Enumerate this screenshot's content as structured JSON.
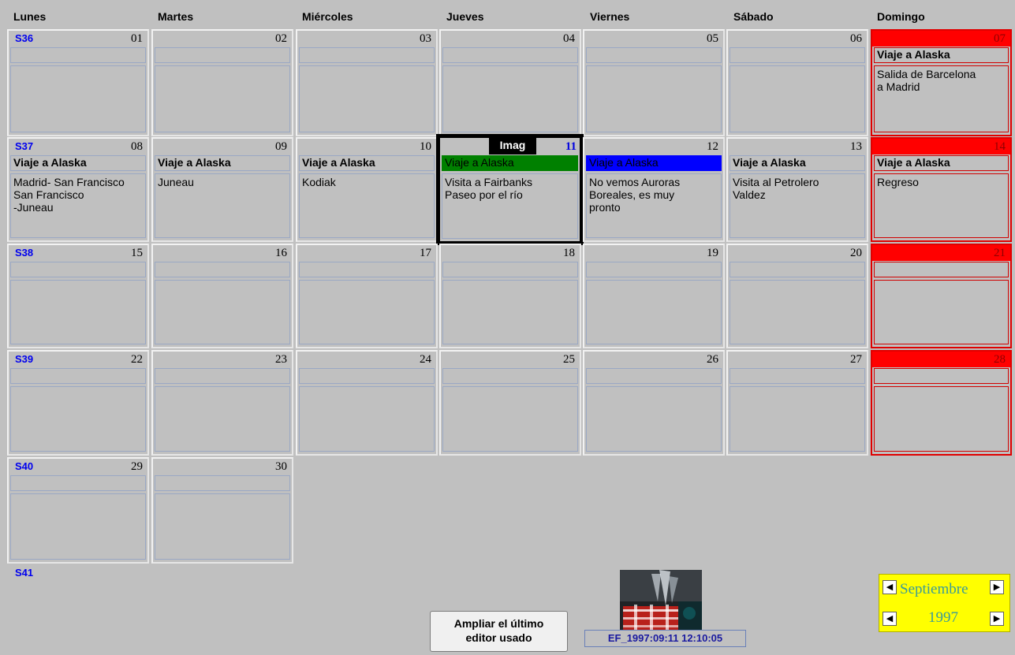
{
  "days": [
    "Lunes",
    "Martes",
    "Miércoles",
    "Jueves",
    "Viernes",
    "Sábado",
    "Domingo"
  ],
  "weeks": [
    "S36",
    "S37",
    "S38",
    "S39",
    "S40",
    "S41"
  ],
  "dates": {
    "r0": [
      "01",
      "02",
      "03",
      "04",
      "05",
      "06",
      "07"
    ],
    "r1": [
      "08",
      "09",
      "10",
      "11",
      "12",
      "13",
      "14"
    ],
    "r2": [
      "15",
      "16",
      "17",
      "18",
      "19",
      "20",
      "21"
    ],
    "r3": [
      "22",
      "23",
      "24",
      "25",
      "26",
      "27",
      "28"
    ],
    "r4": [
      "29",
      "30"
    ]
  },
  "events": {
    "d07": {
      "title": "Viaje a Alaska",
      "notes": "Salida de Barcelona\na Madrid"
    },
    "d08": {
      "title": "Viaje a Alaska",
      "notes": "Madrid- San Francisco\nSan Francisco\n-Juneau"
    },
    "d09": {
      "title": "Viaje a Alaska",
      "notes": "Juneau"
    },
    "d10": {
      "title": "Viaje a Alaska",
      "notes": "Kodiak"
    },
    "d11": {
      "title": "Viaje a Alaska",
      "notes": "Visita a Fairbanks\nPaseo por el río",
      "title_bg": "#008000",
      "tag": "Imag"
    },
    "d12": {
      "title": "Viaje a Alaska",
      "notes": "No vemos Auroras\nBoreales, es muy\npronto",
      "title_bg": "#0000ff"
    },
    "d13": {
      "title": "Viaje a Alaska",
      "notes": "Visita al Petrolero\nValdez"
    },
    "d14": {
      "title": "Viaje a Alaska",
      "notes": "Regreso"
    }
  },
  "footer": {
    "expand_button": "Ampliar el último\neditor usado",
    "photo_caption": "EF_1997:09:11 12:10:05",
    "month": "Septiembre",
    "year": "1997"
  },
  "colors": {
    "background": "#c0c0c0",
    "sunday": "#ff0000",
    "week_label": "#0000ee",
    "nav_panel": "#ffff00"
  }
}
